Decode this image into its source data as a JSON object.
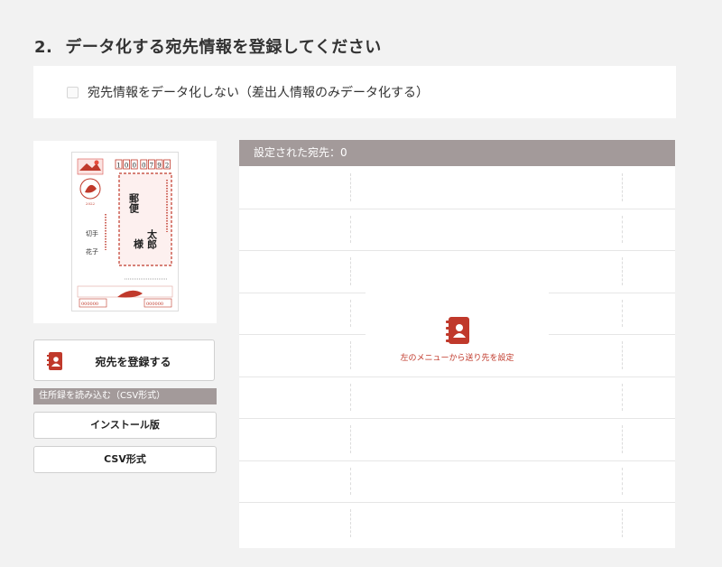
{
  "step": {
    "number": "2.",
    "title": "データ化する宛先情報を登録してください"
  },
  "option": {
    "label": "宛先情報をデータ化しない（差出人情報のみデータ化する）",
    "checked": false
  },
  "postcard": {
    "postal_code": "1000792",
    "recipient_name_lines": [
      "郵便",
      "太郎"
    ],
    "recipient_honorific": "様",
    "sender_name_lines": [
      "切手",
      "花子"
    ],
    "stamp_year": "2022",
    "sender_postal": "000000",
    "footer_postal": "000000"
  },
  "sidebar": {
    "register_button": "宛先を登録する",
    "csv_section_title": "住所録を読み込む（CSV形式）",
    "install_button": "インストール版",
    "csv_button": "CSV形式"
  },
  "destinations": {
    "header": "設定された宛先：0",
    "empty_message": "左のメニューから送り先を設定"
  },
  "colors": {
    "accent_red": "#c0392b",
    "header_gray": "#a39a9a"
  }
}
